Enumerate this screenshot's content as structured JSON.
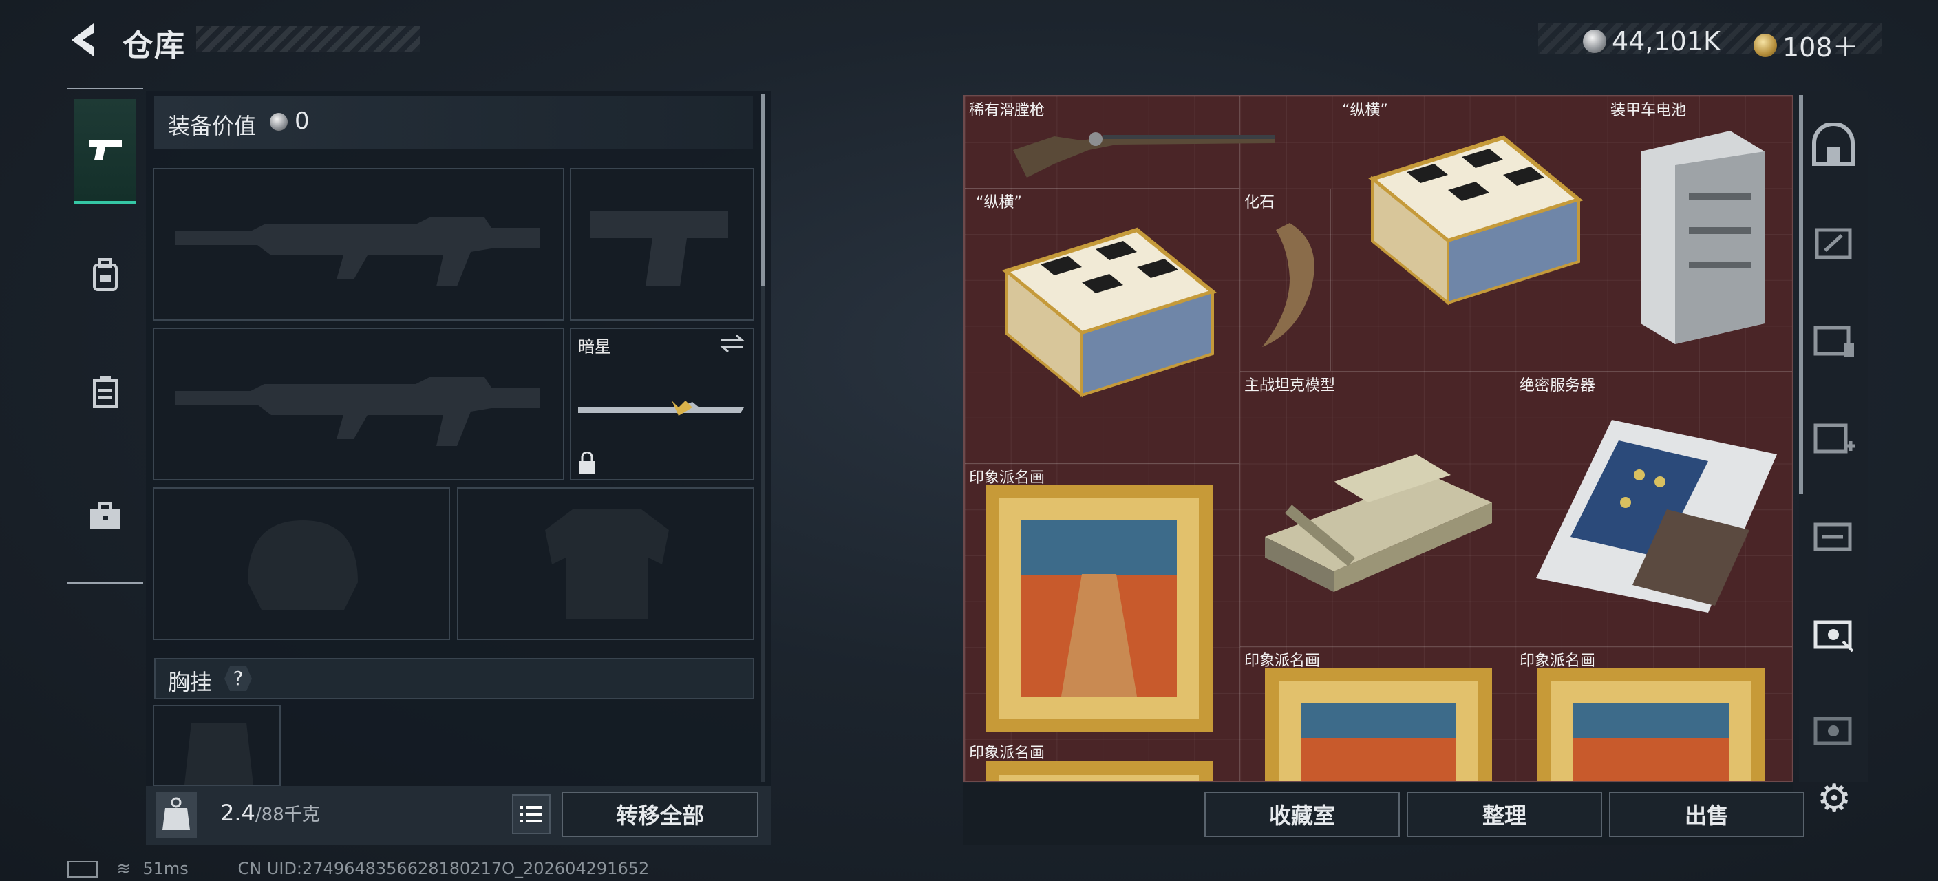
{
  "header": {
    "title": "仓库",
    "currency": [
      {
        "icon": "silver-coin-icon",
        "value": "44,101K"
      },
      {
        "icon": "gold-coin-icon",
        "value": "108＋"
      }
    ]
  },
  "tabs": [
    {
      "icon": "pistol-icon",
      "active": true
    },
    {
      "icon": "backpack-icon",
      "active": false
    },
    {
      "icon": "vest-icon",
      "active": false
    },
    {
      "icon": "toolbox-icon",
      "active": false
    }
  ],
  "equipment": {
    "value_label": "装备价值",
    "value": "0",
    "melee_name": "暗星",
    "chest_label": "胸挂",
    "chest_help": "?",
    "weight_current": "2.4",
    "weight_max": "/88千克",
    "transfer_all": "转移全部"
  },
  "storage_items": [
    {
      "name": "稀有滑膛枪"
    },
    {
      "name": "“纵横”"
    },
    {
      "name": "装甲车电池"
    },
    {
      "name": "“纵横”"
    },
    {
      "name": "化石"
    },
    {
      "name": "主战坦克模型"
    },
    {
      "name": "绝密服务器"
    },
    {
      "name": "印象派名画"
    },
    {
      "name": "印象派名画"
    },
    {
      "name": "印象派名画"
    },
    {
      "name": "印象派名画"
    }
  ],
  "actions": {
    "collection": "收藏室",
    "organize": "整理",
    "sell": "出售"
  },
  "status": {
    "ping": "51ms",
    "uid": "CN UID:2749648356628180217O_202604291652"
  },
  "colors": {
    "accent": "#35c7a5",
    "storage_bg": "#4a2527"
  }
}
